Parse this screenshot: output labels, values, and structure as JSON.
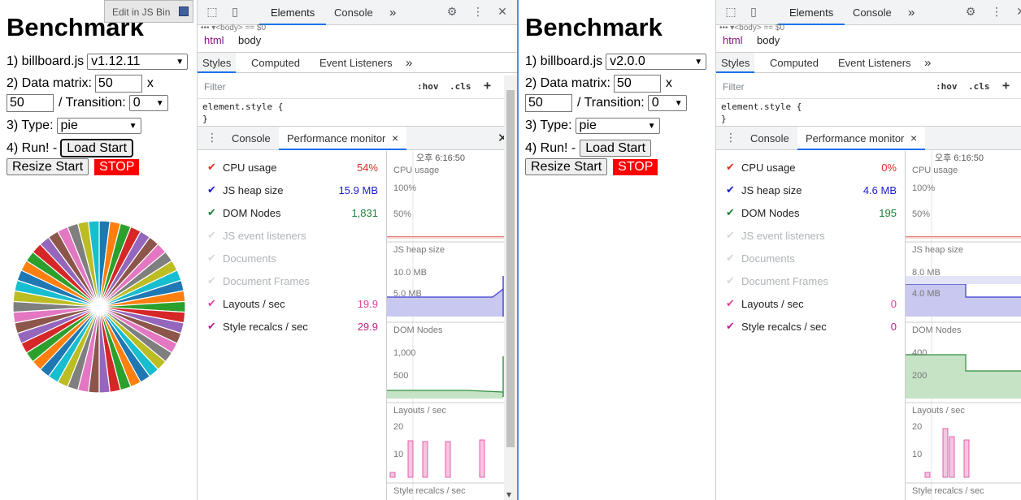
{
  "jsbin": {
    "label": "Edit in JS Bin"
  },
  "panes": [
    {
      "bench": {
        "title": "Benchmark",
        "lib_label": "1) billboard.js",
        "version": "v1.12.11",
        "matrix_label": "2) Data matrix:",
        "matrix_x": "50",
        "x_label": "x",
        "matrix_y": "50",
        "transition_label": "/ Transition:",
        "transition": "0",
        "type_label": "3) Type:",
        "type": "pie",
        "run_label": "4) Run! -",
        "load_btn": "Load Start",
        "resize_btn": "Resize Start",
        "stop_btn": "STOP"
      },
      "devtools": {
        "tabs": [
          "Elements",
          "Console"
        ],
        "more": "»",
        "breadcrumb_cut": "••• ▾<body> == $0",
        "breadcrumb": [
          "html",
          "body"
        ],
        "style_tabs": [
          "Styles",
          "Computed",
          "Event Listeners"
        ],
        "filter_placeholder": "Filter",
        "hov": ":hov",
        "cls": ".cls",
        "plus": "+",
        "element_style_open": "element.style {",
        "element_style_close": "}",
        "drawer_tabs": [
          "Console",
          "Performance monitor"
        ],
        "close_x": "×",
        "drawer_close": "✕",
        "metrics": [
          {
            "name": "CPU usage",
            "value": "54%",
            "color": "#d93025",
            "on": true
          },
          {
            "name": "JS heap size",
            "value": "15.9 MB",
            "color": "#1a1acb",
            "on": true
          },
          {
            "name": "DOM Nodes",
            "value": "1,831",
            "color": "#188038",
            "on": true
          },
          {
            "name": "JS event listeners",
            "value": "",
            "color": "#b0b4b8",
            "on": false
          },
          {
            "name": "Documents",
            "value": "",
            "color": "#b0b4b8",
            "on": false
          },
          {
            "name": "Document Frames",
            "value": "",
            "color": "#b0b4b8",
            "on": false
          },
          {
            "name": "Layouts / sec",
            "value": "19.9",
            "color": "#e040a0",
            "on": true
          },
          {
            "name": "Style recalcs / sec",
            "value": "29.9",
            "color": "#c0208a",
            "on": true
          }
        ],
        "graph": {
          "time": "오후 6:16:50",
          "sections": [
            {
              "label": "CPU usage",
              "ticks": [
                "100%",
                "50%"
              ]
            },
            {
              "label": "JS heap size",
              "ticks": [
                "10.0 MB",
                "5.0 MB"
              ]
            },
            {
              "label": "DOM Nodes",
              "ticks": [
                "1,000",
                "500"
              ]
            },
            {
              "label": "Layouts / sec",
              "ticks": [
                "20",
                "10"
              ]
            },
            {
              "label": "Style recalcs / sec",
              "ticks": []
            }
          ]
        }
      }
    },
    {
      "bench": {
        "title": "Benchmark",
        "lib_label": "1) billboard.js",
        "version": "v2.0.0",
        "matrix_label": "2) Data matrix:",
        "matrix_x": "50",
        "x_label": "x",
        "matrix_y": "50",
        "transition_label": "/ Transition:",
        "transition": "0",
        "type_label": "3) Type:",
        "type": "pie",
        "run_label": "4) Run! -",
        "load_btn": "Load Start",
        "resize_btn": "Resize Start",
        "stop_btn": "STOP"
      },
      "devtools": {
        "tabs": [
          "Elements",
          "Console"
        ],
        "more": "»",
        "breadcrumb_cut": "••• ▾<body> == $0",
        "breadcrumb": [
          "html",
          "body"
        ],
        "style_tabs": [
          "Styles",
          "Computed",
          "Event Listeners"
        ],
        "filter_placeholder": "Filter",
        "hov": ":hov",
        "cls": ".cls",
        "plus": "+",
        "element_style_open": "element.style {",
        "element_style_close": "}",
        "drawer_tabs": [
          "Console",
          "Performance monitor"
        ],
        "close_x": "×",
        "drawer_close": "✕",
        "metrics": [
          {
            "name": "CPU usage",
            "value": "0%",
            "color": "#d93025",
            "on": true
          },
          {
            "name": "JS heap size",
            "value": "4.6 MB",
            "color": "#1a1acb",
            "on": true
          },
          {
            "name": "DOM Nodes",
            "value": "195",
            "color": "#188038",
            "on": true
          },
          {
            "name": "JS event listeners",
            "value": "",
            "color": "#b0b4b8",
            "on": false
          },
          {
            "name": "Documents",
            "value": "",
            "color": "#b0b4b8",
            "on": false
          },
          {
            "name": "Document Frames",
            "value": "",
            "color": "#b0b4b8",
            "on": false
          },
          {
            "name": "Layouts / sec",
            "value": "0",
            "color": "#e040a0",
            "on": true
          },
          {
            "name": "Style recalcs / sec",
            "value": "0",
            "color": "#c0208a",
            "on": true
          }
        ],
        "graph": {
          "time": "오후 6:16:50",
          "sections": [
            {
              "label": "CPU usage",
              "ticks": [
                "100%",
                "50%"
              ]
            },
            {
              "label": "JS heap size",
              "ticks": [
                "8.0 MB",
                "4.0 MB"
              ]
            },
            {
              "label": "DOM Nodes",
              "ticks": [
                "400",
                "200"
              ]
            },
            {
              "label": "Layouts / sec",
              "ticks": [
                "20",
                "10"
              ]
            },
            {
              "label": "Style recalcs / sec",
              "ticks": []
            }
          ]
        }
      }
    }
  ],
  "pie_colors": [
    "#1f77b4",
    "#ff7f0e",
    "#2ca02c",
    "#d62728",
    "#9467bd",
    "#8c564b",
    "#e377c2",
    "#7f7f7f",
    "#bcbd22",
    "#17becf"
  ]
}
